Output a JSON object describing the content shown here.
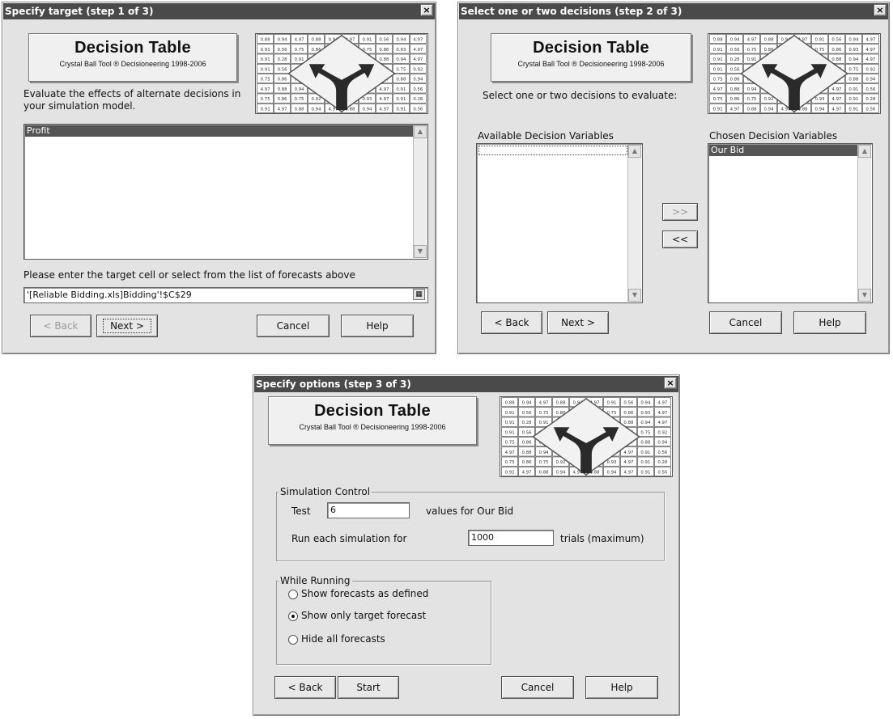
{
  "graphic_values": [
    "0.88",
    "0.94",
    "4.97",
    "0.88",
    "0.94",
    "4.97",
    "0.91",
    "0.56",
    "0.94",
    "4.97",
    "0.91",
    "0.56",
    "0.75",
    "0.86",
    "0.75",
    "0.92",
    "0.75",
    "0.86",
    "0.93",
    "4.97",
    "0.91",
    "0.28",
    "0.91",
    "4.97"
  ],
  "dialog1": {
    "title": "Specify target (step 1 of 3)",
    "close": "×",
    "logo_title": "Decision Table",
    "logo_sub": "Crystal Ball Tool ® Decisioneering 1998-2006",
    "description": "Evaluate the effects of alternate decisions in your simulation model.",
    "list_items": [
      "Profit"
    ],
    "prompt": "Please enter the target cell or select from the list of forecasts above",
    "target_value": "'[Reliable Bidding.xls]Bidding'!$C$29",
    "back": "< Back",
    "next": "Next >",
    "cancel": "Cancel",
    "help": "Help"
  },
  "dialog2": {
    "title": "Select one or two decisions (step 2 of 3)",
    "close": "×",
    "logo_title": "Decision Table",
    "logo_sub": "Crystal Ball Tool ® Decisioneering 1998-2006",
    "instruction": "Select one or two decisions to evaluate:",
    "available_label": "Available Decision Variables",
    "chosen_label": "Chosen Decision Variables",
    "chosen_items": [
      "Our Bid"
    ],
    "add": ">>",
    "remove": "<<",
    "back": "< Back",
    "next": "Next >",
    "cancel": "Cancel",
    "help": "Help"
  },
  "dialog3": {
    "title": "Specify options (step 3 of 3)",
    "close": "×",
    "logo_title": "Decision Table",
    "logo_sub": "Crystal Ball Tool ® Decisioneering 1998-2006",
    "sim_group": "Simulation Control",
    "test_label": "Test",
    "test_value": "6",
    "values_for": "values for Our Bid",
    "run_label": "Run each simulation for",
    "trials_value": "1000",
    "trials_label": "trials (maximum)",
    "running_group": "While Running",
    "radio_options": [
      "Show forecasts as defined",
      "Show only target forecast",
      "Hide all forecasts"
    ],
    "selected_option": "Show only target forecast",
    "back": "< Back",
    "start": "Start",
    "cancel": "Cancel",
    "help": "Help"
  },
  "colors": {
    "titlebar": "#4a4a4a",
    "dialog_bg": "#e3e3e3",
    "selection": "#555555"
  }
}
